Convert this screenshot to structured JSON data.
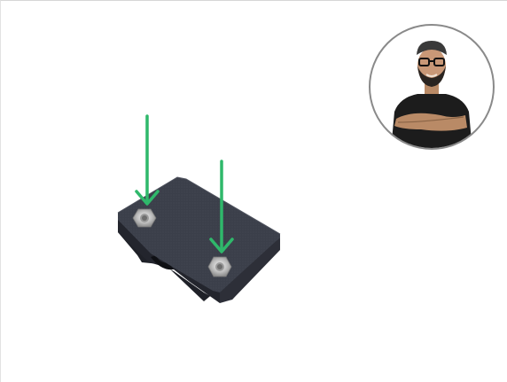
{
  "scene": {
    "subject": "printed-part-with-nuts",
    "colors": {
      "part_top": "#3a3d48",
      "part_side": "#2a2c34",
      "part_dark": "#1c1d23",
      "arrow": "#2fb86b",
      "nut": "#c9c9c9",
      "background": "#ffffff",
      "avatar_ring": "#888888"
    },
    "icons": [
      "down-arrow-icon",
      "down-arrow-icon",
      "avatar-icon"
    ]
  }
}
